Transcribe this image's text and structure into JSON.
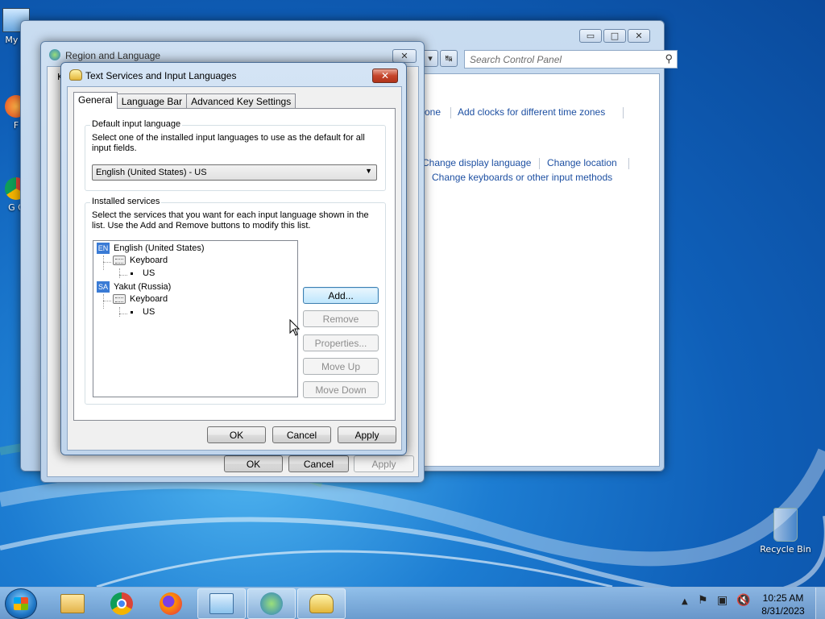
{
  "desktop": {
    "icons": [
      {
        "id": "my-computer",
        "label": "My C"
      },
      {
        "id": "firefox",
        "label": "F"
      },
      {
        "id": "chrome",
        "label": "G C"
      },
      {
        "id": "recycle-bin",
        "label": "Recycle Bin"
      }
    ]
  },
  "control_panel": {
    "search_placeholder": "Search Control Panel",
    "links": {
      "time_zone_partial": "one",
      "add_clocks": "Add clocks for different time zones",
      "change_display_language": "Change display language",
      "change_location": "Change location",
      "change_keyboards": "Change keyboards or other input methods"
    }
  },
  "region_language": {
    "title": "Region and Language",
    "tab_partial": "K",
    "buttons": {
      "ok": "OK",
      "cancel": "Cancel",
      "apply": "Apply"
    }
  },
  "text_services": {
    "title": "Text Services and Input Languages",
    "close_label": "✕",
    "tabs": [
      "General",
      "Language Bar",
      "Advanced Key Settings"
    ],
    "default_input": {
      "group_title": "Default input language",
      "description": "Select one of the installed input languages to use as the default for all input fields.",
      "selected": "English (United States) - US"
    },
    "installed_services": {
      "group_title": "Installed services",
      "description": "Select the services that you want for each input language shown in the list. Use the Add and Remove buttons to modify this list.",
      "tree": [
        {
          "badge": "EN",
          "language": "English (United States)",
          "service": "Keyboard",
          "layout": "US"
        },
        {
          "badge": "SA",
          "language": "Yakut (Russia)",
          "service": "Keyboard",
          "layout": "US"
        }
      ],
      "buttons": {
        "add": "Add...",
        "remove": "Remove",
        "properties": "Properties...",
        "move_up": "Move Up",
        "move_down": "Move Down"
      }
    },
    "buttons": {
      "ok": "OK",
      "cancel": "Cancel",
      "apply": "Apply"
    }
  },
  "taskbar": {
    "clock_time": "10:25 AM",
    "clock_date": "8/31/2023"
  }
}
